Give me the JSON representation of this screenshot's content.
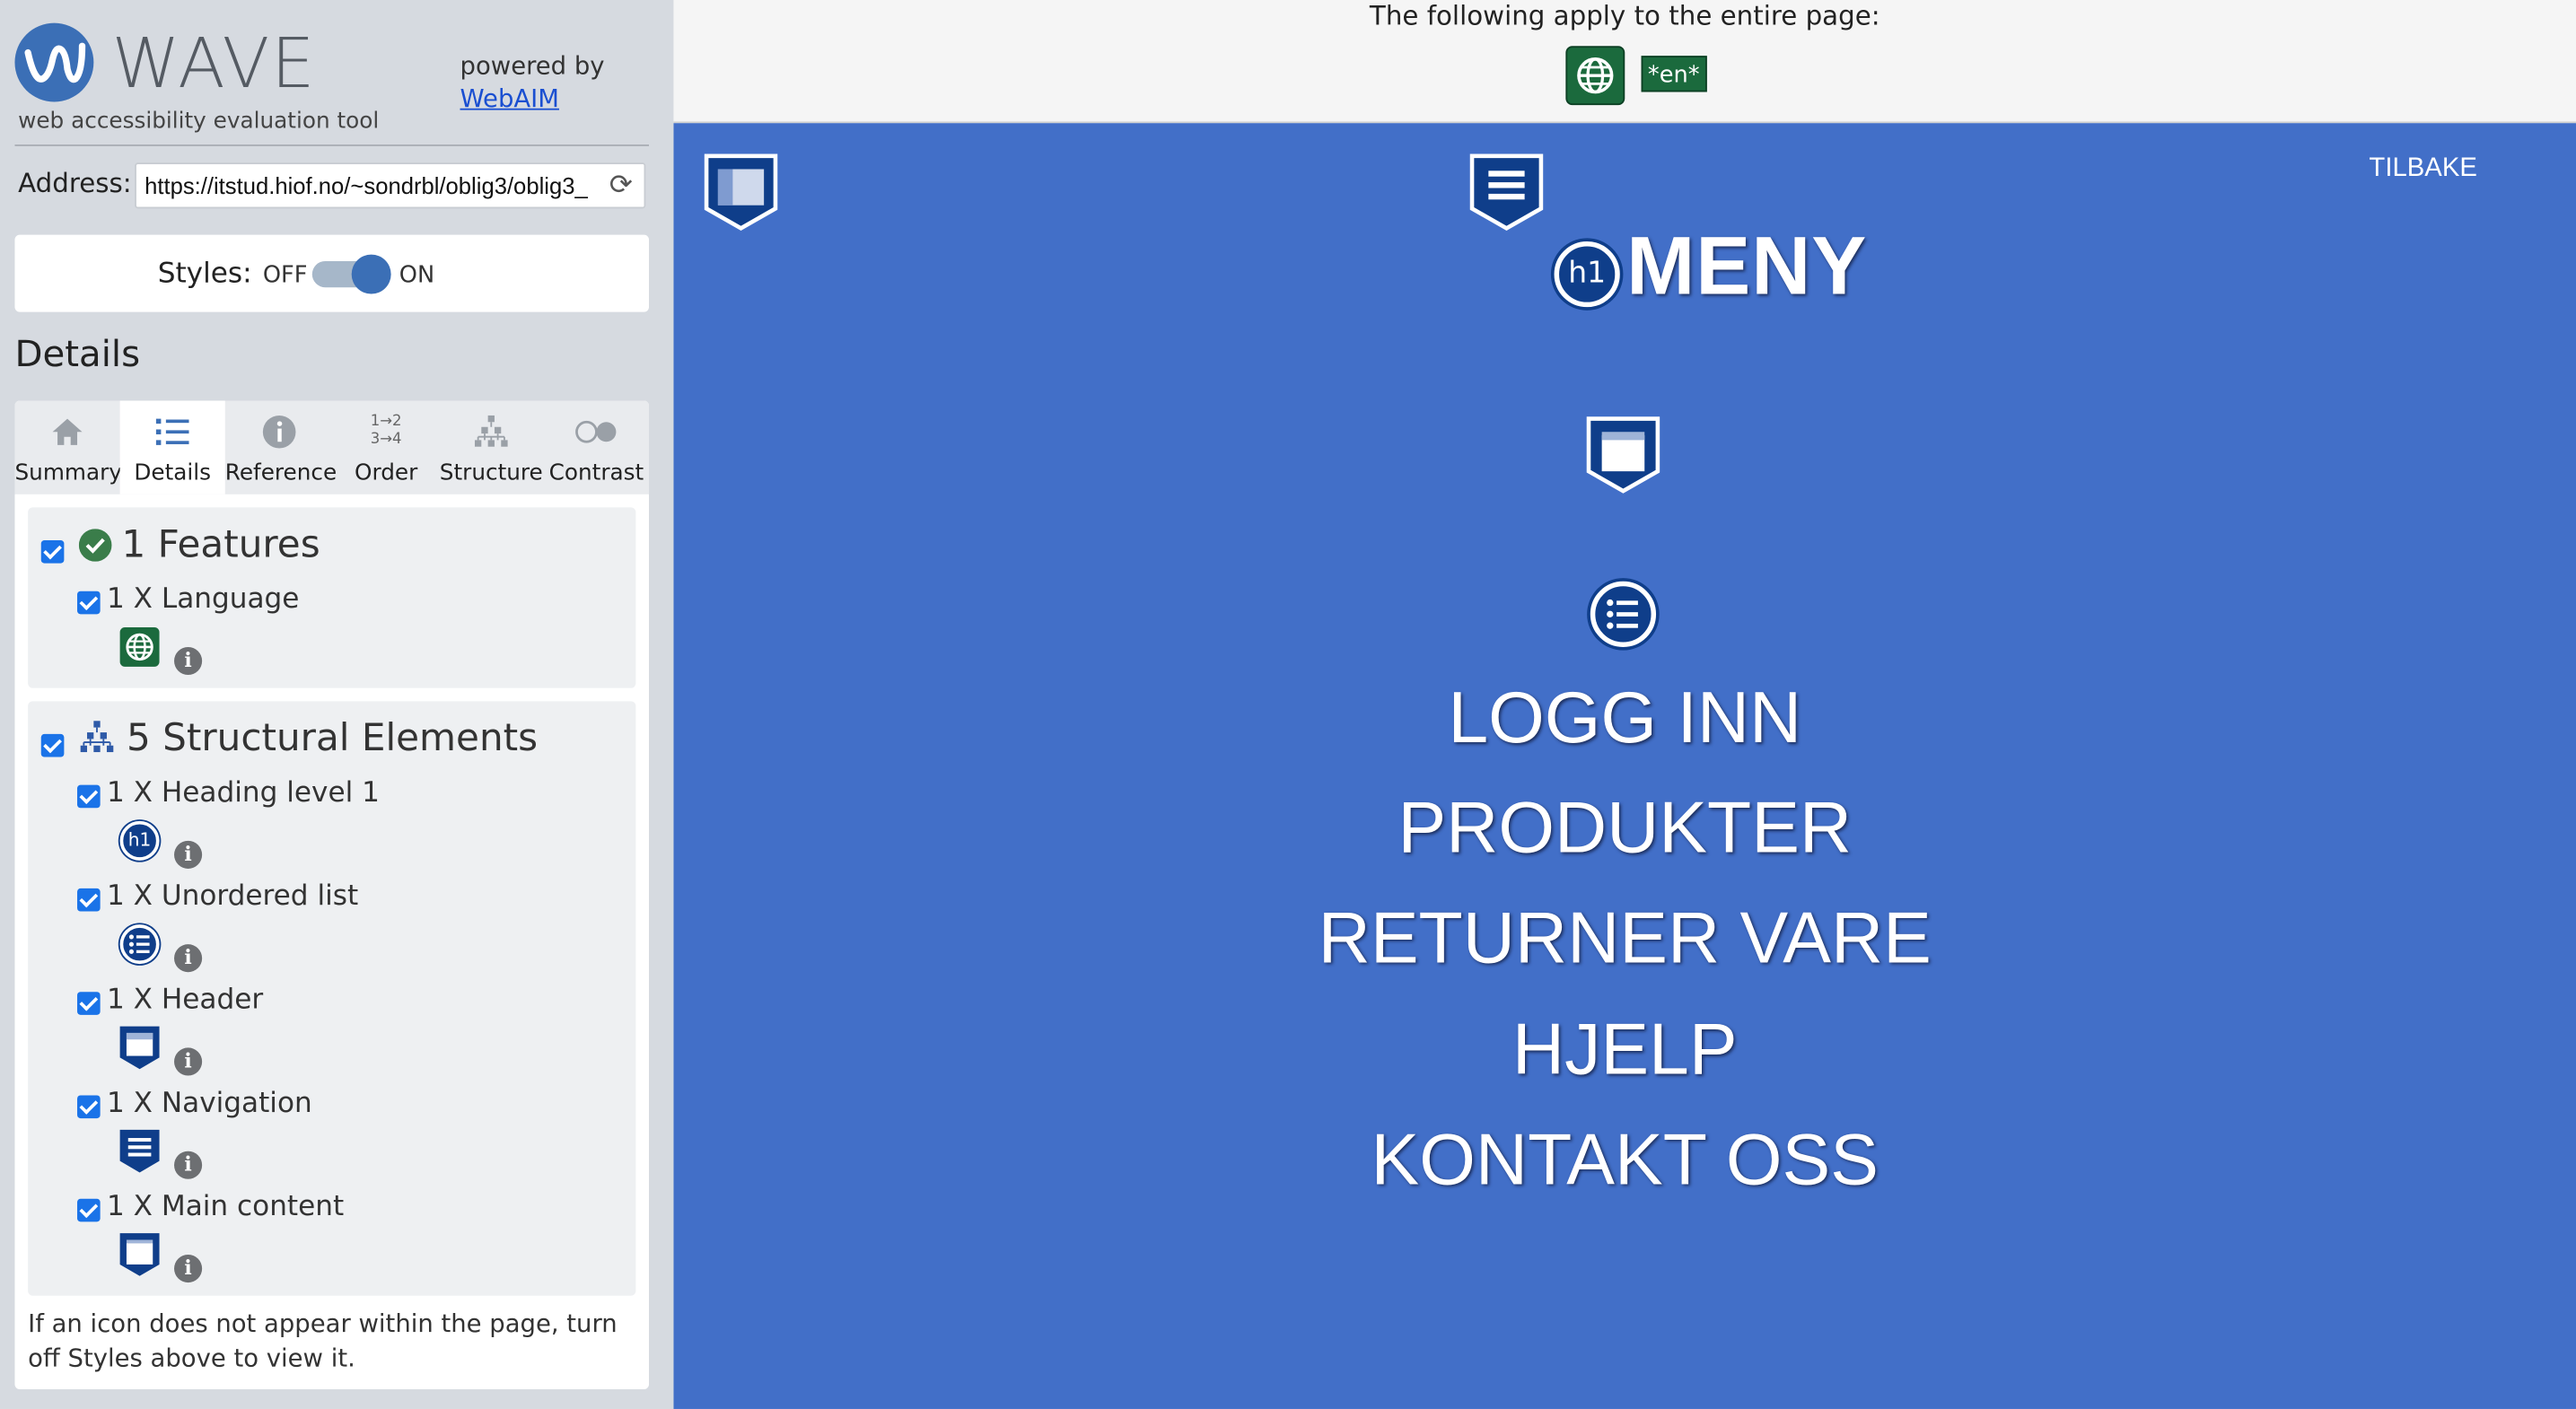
{
  "wave": {
    "logo_text": "WAVE",
    "subtitle": "web accessibility evaluation tool",
    "powered_by": "powered by",
    "webaim_link": "WebAIM",
    "address_label": "Address:",
    "address_value": "https://itstud.hiof.no/~sondrbl/oblig3/oblig3_",
    "styles_label": "Styles:",
    "styles_off": "OFF",
    "styles_on": "ON",
    "details_title": "Details",
    "tabs": [
      {
        "label": "Summary",
        "icon": "home-icon"
      },
      {
        "label": "Details",
        "icon": "list-icon"
      },
      {
        "label": "Reference",
        "icon": "info-icon"
      },
      {
        "label": "Order",
        "icon": "order-icon"
      },
      {
        "label": "Structure",
        "icon": "structure-icon"
      },
      {
        "label": "Contrast",
        "icon": "contrast-icon"
      }
    ],
    "features": {
      "title": "1 Features",
      "items": [
        {
          "label": "1 X Language",
          "icon": "language-icon"
        }
      ]
    },
    "structural": {
      "title": "5 Structural Elements",
      "items": [
        {
          "label": "1 X Heading level 1",
          "icon": "h1-icon",
          "icon_text": "h1"
        },
        {
          "label": "1 X Unordered list",
          "icon": "unordered-list-icon"
        },
        {
          "label": "1 X Header",
          "icon": "header-icon"
        },
        {
          "label": "1 X Navigation",
          "icon": "navigation-icon"
        },
        {
          "label": "1 X Main content",
          "icon": "main-content-icon"
        }
      ]
    },
    "note": "If an icon does not appear within the page, turn off Styles above to view it."
  },
  "page": {
    "apply_text": "The following apply to the entire page:",
    "lang_badge": "*en*",
    "tilbake": "TILBAKE",
    "heading": "MENY",
    "heading_icon_text": "h1",
    "nav_items": [
      "LOGG INN",
      "PRODUKTER",
      "RETURNER VARE",
      "HJELP",
      "KONTAKT OSS"
    ],
    "bg_color": "#426fc8"
  }
}
